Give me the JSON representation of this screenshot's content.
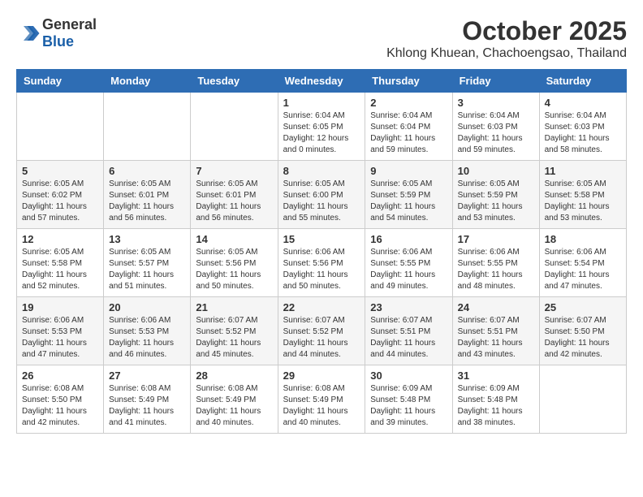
{
  "header": {
    "logo_general": "General",
    "logo_blue": "Blue",
    "month": "October 2025",
    "location": "Khlong Khuean, Chachoengsao, Thailand"
  },
  "weekdays": [
    "Sunday",
    "Monday",
    "Tuesday",
    "Wednesday",
    "Thursday",
    "Friday",
    "Saturday"
  ],
  "weeks": [
    [
      {
        "day": "",
        "sunrise": "",
        "sunset": "",
        "daylight": ""
      },
      {
        "day": "",
        "sunrise": "",
        "sunset": "",
        "daylight": ""
      },
      {
        "day": "",
        "sunrise": "",
        "sunset": "",
        "daylight": ""
      },
      {
        "day": "1",
        "sunrise": "Sunrise: 6:04 AM",
        "sunset": "Sunset: 6:05 PM",
        "daylight": "Daylight: 12 hours and 0 minutes."
      },
      {
        "day": "2",
        "sunrise": "Sunrise: 6:04 AM",
        "sunset": "Sunset: 6:04 PM",
        "daylight": "Daylight: 11 hours and 59 minutes."
      },
      {
        "day": "3",
        "sunrise": "Sunrise: 6:04 AM",
        "sunset": "Sunset: 6:03 PM",
        "daylight": "Daylight: 11 hours and 59 minutes."
      },
      {
        "day": "4",
        "sunrise": "Sunrise: 6:04 AM",
        "sunset": "Sunset: 6:03 PM",
        "daylight": "Daylight: 11 hours and 58 minutes."
      }
    ],
    [
      {
        "day": "5",
        "sunrise": "Sunrise: 6:05 AM",
        "sunset": "Sunset: 6:02 PM",
        "daylight": "Daylight: 11 hours and 57 minutes."
      },
      {
        "day": "6",
        "sunrise": "Sunrise: 6:05 AM",
        "sunset": "Sunset: 6:01 PM",
        "daylight": "Daylight: 11 hours and 56 minutes."
      },
      {
        "day": "7",
        "sunrise": "Sunrise: 6:05 AM",
        "sunset": "Sunset: 6:01 PM",
        "daylight": "Daylight: 11 hours and 56 minutes."
      },
      {
        "day": "8",
        "sunrise": "Sunrise: 6:05 AM",
        "sunset": "Sunset: 6:00 PM",
        "daylight": "Daylight: 11 hours and 55 minutes."
      },
      {
        "day": "9",
        "sunrise": "Sunrise: 6:05 AM",
        "sunset": "Sunset: 5:59 PM",
        "daylight": "Daylight: 11 hours and 54 minutes."
      },
      {
        "day": "10",
        "sunrise": "Sunrise: 6:05 AM",
        "sunset": "Sunset: 5:59 PM",
        "daylight": "Daylight: 11 hours and 53 minutes."
      },
      {
        "day": "11",
        "sunrise": "Sunrise: 6:05 AM",
        "sunset": "Sunset: 5:58 PM",
        "daylight": "Daylight: 11 hours and 53 minutes."
      }
    ],
    [
      {
        "day": "12",
        "sunrise": "Sunrise: 6:05 AM",
        "sunset": "Sunset: 5:58 PM",
        "daylight": "Daylight: 11 hours and 52 minutes."
      },
      {
        "day": "13",
        "sunrise": "Sunrise: 6:05 AM",
        "sunset": "Sunset: 5:57 PM",
        "daylight": "Daylight: 11 hours and 51 minutes."
      },
      {
        "day": "14",
        "sunrise": "Sunrise: 6:05 AM",
        "sunset": "Sunset: 5:56 PM",
        "daylight": "Daylight: 11 hours and 50 minutes."
      },
      {
        "day": "15",
        "sunrise": "Sunrise: 6:06 AM",
        "sunset": "Sunset: 5:56 PM",
        "daylight": "Daylight: 11 hours and 50 minutes."
      },
      {
        "day": "16",
        "sunrise": "Sunrise: 6:06 AM",
        "sunset": "Sunset: 5:55 PM",
        "daylight": "Daylight: 11 hours and 49 minutes."
      },
      {
        "day": "17",
        "sunrise": "Sunrise: 6:06 AM",
        "sunset": "Sunset: 5:55 PM",
        "daylight": "Daylight: 11 hours and 48 minutes."
      },
      {
        "day": "18",
        "sunrise": "Sunrise: 6:06 AM",
        "sunset": "Sunset: 5:54 PM",
        "daylight": "Daylight: 11 hours and 47 minutes."
      }
    ],
    [
      {
        "day": "19",
        "sunrise": "Sunrise: 6:06 AM",
        "sunset": "Sunset: 5:53 PM",
        "daylight": "Daylight: 11 hours and 47 minutes."
      },
      {
        "day": "20",
        "sunrise": "Sunrise: 6:06 AM",
        "sunset": "Sunset: 5:53 PM",
        "daylight": "Daylight: 11 hours and 46 minutes."
      },
      {
        "day": "21",
        "sunrise": "Sunrise: 6:07 AM",
        "sunset": "Sunset: 5:52 PM",
        "daylight": "Daylight: 11 hours and 45 minutes."
      },
      {
        "day": "22",
        "sunrise": "Sunrise: 6:07 AM",
        "sunset": "Sunset: 5:52 PM",
        "daylight": "Daylight: 11 hours and 44 minutes."
      },
      {
        "day": "23",
        "sunrise": "Sunrise: 6:07 AM",
        "sunset": "Sunset: 5:51 PM",
        "daylight": "Daylight: 11 hours and 44 minutes."
      },
      {
        "day": "24",
        "sunrise": "Sunrise: 6:07 AM",
        "sunset": "Sunset: 5:51 PM",
        "daylight": "Daylight: 11 hours and 43 minutes."
      },
      {
        "day": "25",
        "sunrise": "Sunrise: 6:07 AM",
        "sunset": "Sunset: 5:50 PM",
        "daylight": "Daylight: 11 hours and 42 minutes."
      }
    ],
    [
      {
        "day": "26",
        "sunrise": "Sunrise: 6:08 AM",
        "sunset": "Sunset: 5:50 PM",
        "daylight": "Daylight: 11 hours and 42 minutes."
      },
      {
        "day": "27",
        "sunrise": "Sunrise: 6:08 AM",
        "sunset": "Sunset: 5:49 PM",
        "daylight": "Daylight: 11 hours and 41 minutes."
      },
      {
        "day": "28",
        "sunrise": "Sunrise: 6:08 AM",
        "sunset": "Sunset: 5:49 PM",
        "daylight": "Daylight: 11 hours and 40 minutes."
      },
      {
        "day": "29",
        "sunrise": "Sunrise: 6:08 AM",
        "sunset": "Sunset: 5:49 PM",
        "daylight": "Daylight: 11 hours and 40 minutes."
      },
      {
        "day": "30",
        "sunrise": "Sunrise: 6:09 AM",
        "sunset": "Sunset: 5:48 PM",
        "daylight": "Daylight: 11 hours and 39 minutes."
      },
      {
        "day": "31",
        "sunrise": "Sunrise: 6:09 AM",
        "sunset": "Sunset: 5:48 PM",
        "daylight": "Daylight: 11 hours and 38 minutes."
      },
      {
        "day": "",
        "sunrise": "",
        "sunset": "",
        "daylight": ""
      }
    ]
  ]
}
